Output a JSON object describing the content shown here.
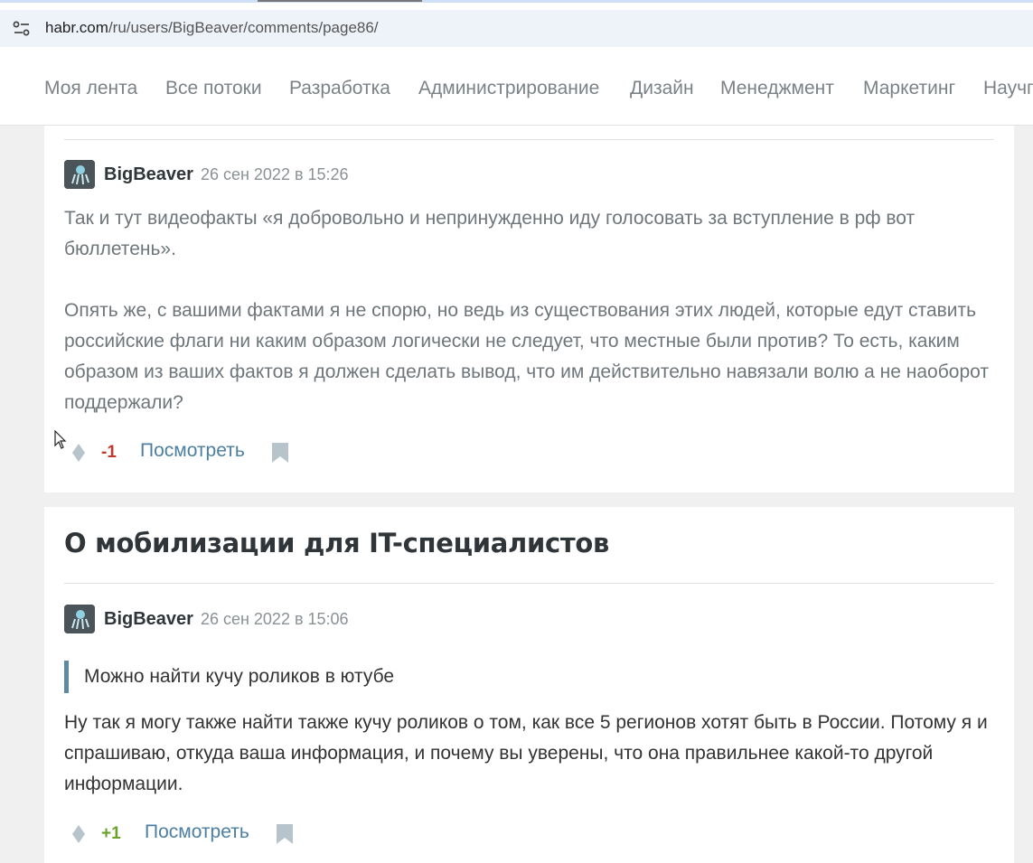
{
  "browser": {
    "url_host": "habr.com",
    "url_path": "/ru/users/BigBeaver/comments/page86/"
  },
  "nav": {
    "items": [
      "Моя лента",
      "Все потоки",
      "Разработка",
      "Администрирование",
      "Дизайн",
      "Менеджмент",
      "Маркетинг",
      "Научп"
    ]
  },
  "comments": [
    {
      "author": "BigBeaver",
      "date": "26 сен 2022 в 15:26",
      "paragraph1": "Так и тут видеофакты «я добровольно и непринужденно иду голосовать за вступление в рф вот бюллетень».",
      "paragraph2": "Опять же, с вашими фактами я не спорю, но ведь из существования этих людей, которые едут ставить российские флаги ни каким образом логически не следует, что местные были против? То есть, каким образом из ваших фактов я должен сделать вывод, что им действительно навязали волю а не наоборот поддержали?",
      "score": "-1",
      "view_label": "Посмотреть"
    },
    {
      "post_title": "О мобилизации для IT-специалистов",
      "author": "BigBeaver",
      "date": "26 сен 2022 в 15:06",
      "quote": "Можно найти кучу роликов в ютубе",
      "paragraph1": "Ну так я могу также найти также кучу роликов о том, как все 5 регионов хотят быть в России. Потому я и спрашиваю, откуда ваша информация, и почему вы уверены, что она правильнее какой-то другой информации.",
      "score": "+1",
      "view_label": "Посмотреть"
    }
  ],
  "colors": {
    "link": "#4c7fa1",
    "negative": "#c0392b",
    "positive": "#6aa32a",
    "quote_border": "#5d8aa0"
  }
}
